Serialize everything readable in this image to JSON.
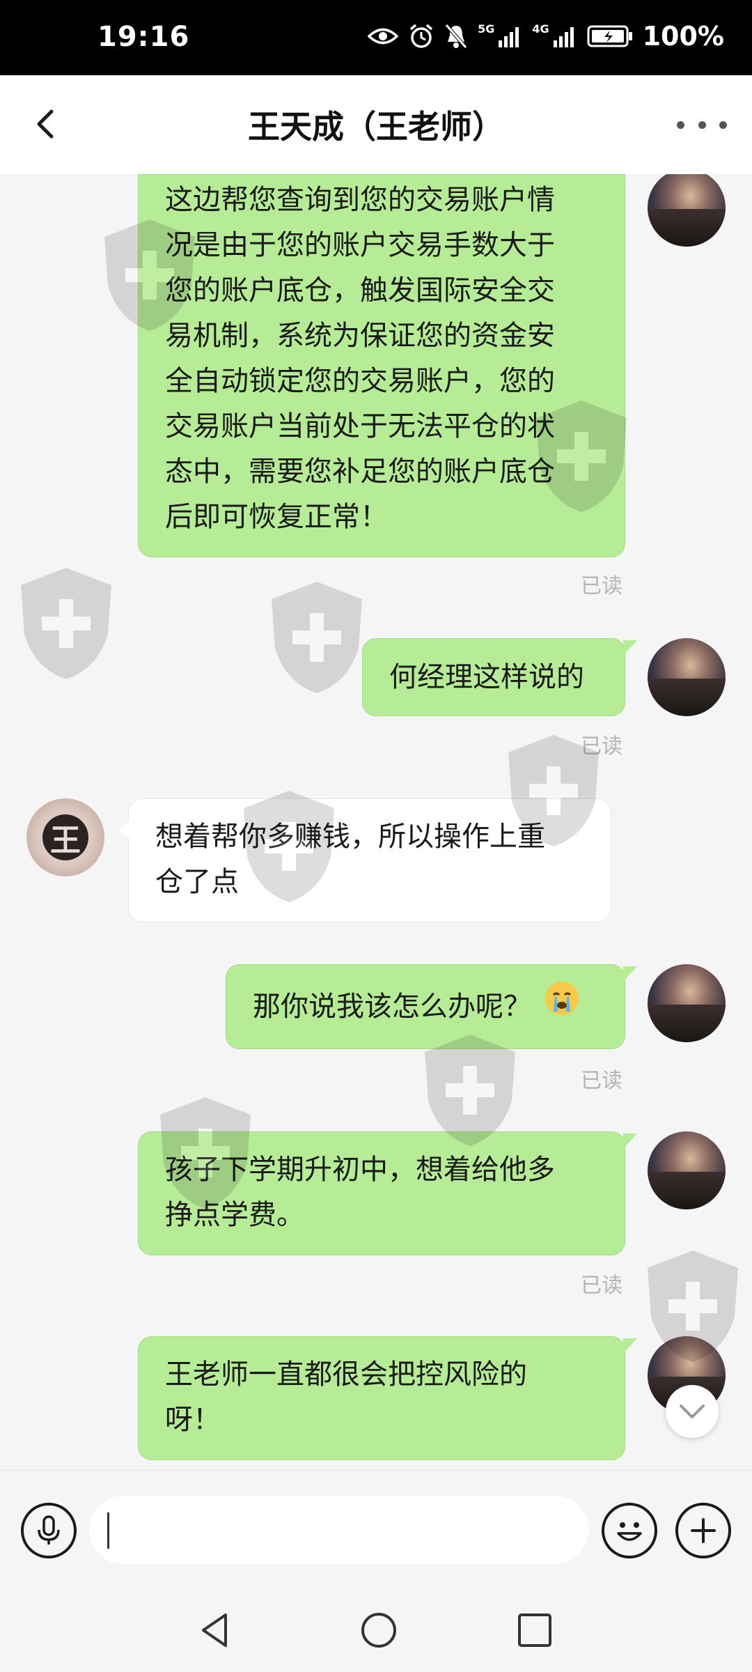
{
  "status_bar": {
    "time": "19:16",
    "net_5g": "5G",
    "net_4g": "4G",
    "battery": "100%"
  },
  "header": {
    "title": "王天成（王老师）"
  },
  "messages": [
    {
      "direction": "sent",
      "lines": [
        "这边帮您查询到您的交易账户情",
        "况是由于您的账户交易手数大于",
        "您的账户底仓，触发国际安全交",
        "易机制，系统为保证您的资金安",
        "全自动锁定您的交易账户，您的",
        "交易账户当前处于无法平仓的状",
        "态中，需要您补足您的账户底仓",
        "后即可恢复正常！"
      ],
      "status": "已读"
    },
    {
      "direction": "sent",
      "lines": [
        "何经理这样说的"
      ],
      "status": "已读"
    },
    {
      "direction": "received",
      "lines": [
        "想着帮你多赚钱，所以操作上重",
        "仓了点"
      ]
    },
    {
      "direction": "sent",
      "lines": [
        "那你说我该怎么办呢？"
      ],
      "emoji": "crying-face",
      "status": "已读"
    },
    {
      "direction": "sent",
      "lines": [
        "孩子下学期升初中，想着给他多",
        "挣点学费。"
      ],
      "status": "已读"
    },
    {
      "direction": "sent",
      "lines": [
        "王老师一直都很会把控风险的",
        "呀！"
      ]
    }
  ],
  "peer_avatar_char": "王",
  "input": {
    "value": "",
    "placeholder": ""
  },
  "colors": {
    "sent_bubble": "#b6ec96",
    "received_bubble": "#ffffff",
    "read_label": "#b4b4b4"
  }
}
